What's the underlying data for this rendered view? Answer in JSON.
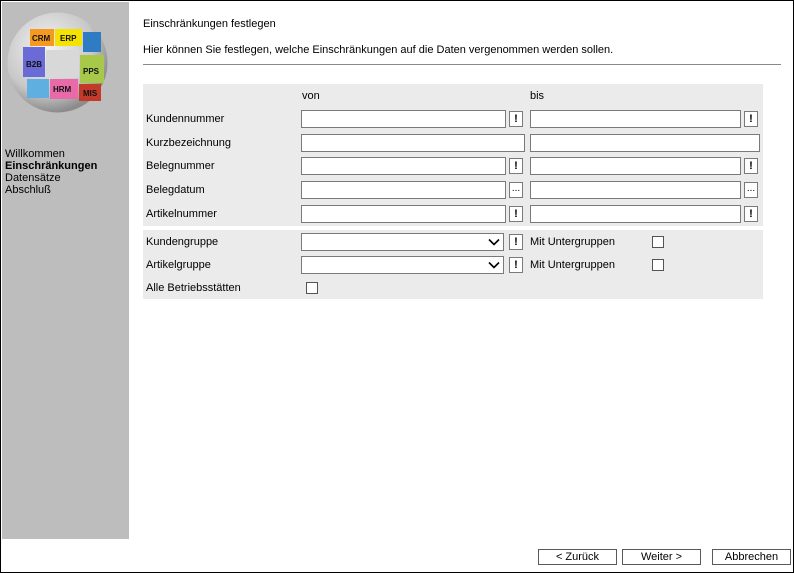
{
  "sidebar": {
    "logo_tiles": [
      "CRM",
      "ERP",
      "B2B",
      "PPS",
      "HRM",
      "MIS"
    ],
    "nav": [
      {
        "label": "Willkommen"
      },
      {
        "label": "Einschränkungen"
      },
      {
        "label": "Datensätze"
      },
      {
        "label": "Abschluß"
      }
    ],
    "active_index": 1
  },
  "header": {
    "title": "Einschränkungen festlegen",
    "description": "Hier können Sie festlegen, welche Einschränkungen auf die Daten vergenommen werden sollen."
  },
  "range": {
    "col_from": "von",
    "col_to": "bis",
    "rows": [
      {
        "label": "Kundennummer",
        "from": "",
        "to": "",
        "button": "!"
      },
      {
        "label": "Kurzbezeichnung",
        "from": "",
        "to": ""
      },
      {
        "label": "Belegnummer",
        "from": "",
        "to": "",
        "button": "!"
      },
      {
        "label": "Belegdatum",
        "from": "",
        "to": "",
        "button": "..."
      },
      {
        "label": "Artikelnummer",
        "from": "",
        "to": "",
        "button": "!"
      }
    ]
  },
  "groups": {
    "kundengruppe": {
      "label": "Kundengruppe",
      "value": "",
      "button": "!",
      "sub_label": "Mit Untergruppen",
      "sub_checked": false
    },
    "artikelgruppe": {
      "label": "Artikelgruppe",
      "value": "",
      "button": "!",
      "sub_label": "Mit Untergruppen",
      "sub_checked": false
    },
    "alle_betriebsstaetten": {
      "label": "Alle Betriebsstätten",
      "checked": false
    }
  },
  "footer": {
    "back": "< Zurück",
    "next": "Weiter >",
    "cancel": "Abbrechen"
  }
}
